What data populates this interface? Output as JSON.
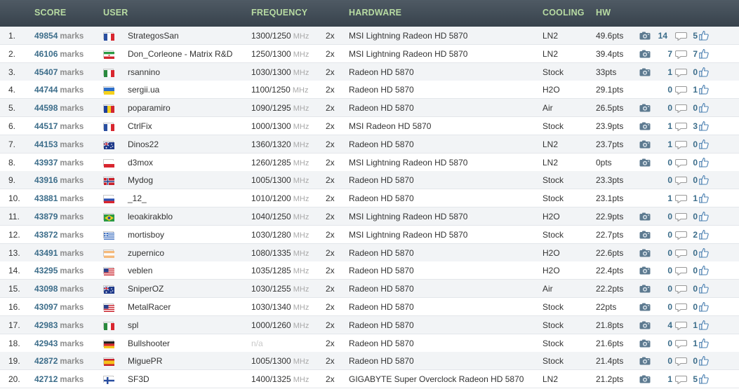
{
  "header": {
    "score": "SCORE",
    "user": "USER",
    "frequency": "FREQUENCY",
    "hardware": "HARDWARE",
    "cooling": "COOLING",
    "hw": "HW"
  },
  "marks_label": "marks",
  "mhz_label": "MHz",
  "colors": {
    "header_bg": "#3f4a54",
    "header_text": "#b7dba2",
    "score": "#3c6d8a",
    "comment_icon": "#9a9a9a",
    "like_icon": "#4a7fb0"
  },
  "rows": [
    {
      "rank": "1.",
      "score": "49854",
      "user": "StrategosSan",
      "flag": "france",
      "frequency": "1300/1250",
      "cards": "2x",
      "hardware": "MSI Lightning Radeon HD 5870",
      "cooling": "LN2",
      "points": "49.6pts",
      "photo": true,
      "comments": "14",
      "likes": "5"
    },
    {
      "rank": "2.",
      "score": "46106",
      "user": "Don_Corleone - Matrix R&D",
      "flag": "iran",
      "frequency": "1250/1300",
      "cards": "2x",
      "hardware": "MSI Lightning Radeon HD 5870",
      "cooling": "LN2",
      "points": "39.4pts",
      "photo": true,
      "comments": "7",
      "likes": "7"
    },
    {
      "rank": "3.",
      "score": "45407",
      "user": "rsannino",
      "flag": "italy",
      "frequency": "1030/1300",
      "cards": "2x",
      "hardware": "Radeon HD 5870",
      "cooling": "Stock",
      "points": "33pts",
      "photo": true,
      "comments": "1",
      "likes": "0"
    },
    {
      "rank": "4.",
      "score": "44744",
      "user": "sergii.ua",
      "flag": "ukraine",
      "frequency": "1100/1250",
      "cards": "2x",
      "hardware": "Radeon HD 5870",
      "cooling": "H2O",
      "points": "29.1pts",
      "photo": false,
      "comments": "0",
      "likes": "1"
    },
    {
      "rank": "5.",
      "score": "44598",
      "user": "poparamiro",
      "flag": "romania",
      "frequency": "1090/1295",
      "cards": "2x",
      "hardware": "Radeon HD 5870",
      "cooling": "Air",
      "points": "26.5pts",
      "photo": true,
      "comments": "0",
      "likes": "0"
    },
    {
      "rank": "6.",
      "score": "44517",
      "user": "CtrlFix",
      "flag": "france",
      "frequency": "1000/1300",
      "cards": "2x",
      "hardware": "MSI Radeon HD 5870",
      "cooling": "Stock",
      "points": "23.9pts",
      "photo": true,
      "comments": "1",
      "likes": "3"
    },
    {
      "rank": "7.",
      "score": "44153",
      "user": "Dinos22",
      "flag": "australia",
      "frequency": "1360/1320",
      "cards": "2x",
      "hardware": "Radeon HD 5870",
      "cooling": "LN2",
      "points": "23.7pts",
      "photo": true,
      "comments": "1",
      "likes": "0"
    },
    {
      "rank": "8.",
      "score": "43937",
      "user": "d3mox",
      "flag": "poland",
      "frequency": "1260/1285",
      "cards": "2x",
      "hardware": "MSI Lightning Radeon HD 5870",
      "cooling": "LN2",
      "points": "0pts",
      "photo": true,
      "comments": "0",
      "likes": "0"
    },
    {
      "rank": "9.",
      "score": "43916",
      "user": "Mydog",
      "flag": "norway",
      "frequency": "1005/1300",
      "cards": "2x",
      "hardware": "Radeon HD 5870",
      "cooling": "Stock",
      "points": "23.3pts",
      "photo": false,
      "comments": "0",
      "likes": "0"
    },
    {
      "rank": "10.",
      "score": "43881",
      "user": "_12_",
      "flag": "russia",
      "frequency": "1010/1200",
      "cards": "2x",
      "hardware": "Radeon HD 5870",
      "cooling": "Stock",
      "points": "23.1pts",
      "photo": false,
      "comments": "1",
      "likes": "1"
    },
    {
      "rank": "11.",
      "score": "43879",
      "user": "leoakirakblo",
      "flag": "brazil",
      "frequency": "1040/1250",
      "cards": "2x",
      "hardware": "MSI Lightning Radeon HD 5870",
      "cooling": "H2O",
      "points": "22.9pts",
      "photo": true,
      "comments": "0",
      "likes": "0"
    },
    {
      "rank": "12.",
      "score": "43872",
      "user": "mortisboy",
      "flag": "greece",
      "frequency": "1030/1280",
      "cards": "2x",
      "hardware": "MSI Lightning Radeon HD 5870",
      "cooling": "Stock",
      "points": "22.7pts",
      "photo": true,
      "comments": "0",
      "likes": "2"
    },
    {
      "rank": "13.",
      "score": "43491",
      "user": "zupernico",
      "flag": "argentina",
      "frequency": "1080/1335",
      "cards": "2x",
      "hardware": "Radeon HD 5870",
      "cooling": "H2O",
      "points": "22.6pts",
      "photo": true,
      "comments": "0",
      "likes": "0"
    },
    {
      "rank": "14.",
      "score": "43295",
      "user": "veblen",
      "flag": "usa",
      "frequency": "1035/1285",
      "cards": "2x",
      "hardware": "Radeon HD 5870",
      "cooling": "H2O",
      "points": "22.4pts",
      "photo": true,
      "comments": "0",
      "likes": "0"
    },
    {
      "rank": "15.",
      "score": "43098",
      "user": "SniperOZ",
      "flag": "australia",
      "frequency": "1030/1255",
      "cards": "2x",
      "hardware": "Radeon HD 5870",
      "cooling": "Air",
      "points": "22.2pts",
      "photo": true,
      "comments": "0",
      "likes": "0"
    },
    {
      "rank": "16.",
      "score": "43097",
      "user": "MetalRacer",
      "flag": "usa",
      "frequency": "1030/1340",
      "cards": "2x",
      "hardware": "Radeon HD 5870",
      "cooling": "Stock",
      "points": "22pts",
      "photo": true,
      "comments": "0",
      "likes": "0"
    },
    {
      "rank": "17.",
      "score": "42983",
      "user": "spl",
      "flag": "italy",
      "frequency": "1000/1260",
      "cards": "2x",
      "hardware": "Radeon HD 5870",
      "cooling": "Stock",
      "points": "21.8pts",
      "photo": true,
      "comments": "4",
      "likes": "1"
    },
    {
      "rank": "18.",
      "score": "42943",
      "user": "Bullshooter",
      "flag": "germany",
      "frequency": "n/a",
      "cards": "2x",
      "hardware": "Radeon HD 5870",
      "cooling": "Stock",
      "points": "21.6pts",
      "photo": true,
      "comments": "0",
      "likes": "1"
    },
    {
      "rank": "19.",
      "score": "42872",
      "user": "MiguePR",
      "flag": "spain",
      "frequency": "1005/1300",
      "cards": "2x",
      "hardware": "Radeon HD 5870",
      "cooling": "Stock",
      "points": "21.4pts",
      "photo": true,
      "comments": "0",
      "likes": "0"
    },
    {
      "rank": "20.",
      "score": "42712",
      "user": "SF3D",
      "flag": "finland",
      "frequency": "1400/1325",
      "cards": "2x",
      "hardware": "GIGABYTE Super Overclock Radeon HD 5870",
      "cooling": "LN2",
      "points": "21.2pts",
      "photo": true,
      "comments": "1",
      "likes": "5"
    }
  ]
}
